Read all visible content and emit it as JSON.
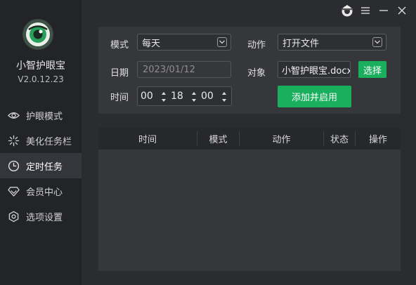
{
  "app": {
    "name": "小智护眼宝",
    "version": "V2.0.12.23"
  },
  "nav": {
    "items": [
      {
        "label": "护眼模式",
        "icon": "eye-icon"
      },
      {
        "label": "美化任务栏",
        "icon": "sparkle-icon"
      },
      {
        "label": "定时任务",
        "icon": "clock-icon",
        "active": true
      },
      {
        "label": "会员中心",
        "icon": "diamond-icon"
      },
      {
        "label": "选项设置",
        "icon": "settings-icon"
      }
    ]
  },
  "titlebar": {
    "icons": [
      "avatar-icon",
      "menu-icon",
      "minimize-icon",
      "close-icon"
    ]
  },
  "form": {
    "mode_label": "模式",
    "mode_value": "每天",
    "action_label": "动作",
    "action_value": "打开文件",
    "date_label": "日期",
    "date_placeholder": "2023/01/12",
    "target_label": "对象",
    "target_value": "小智护眼宝.docx",
    "choose_button": "选择",
    "time_label": "时间",
    "time_hour": "00",
    "time_minute": "18",
    "time_second": "00",
    "add_button": "添加并启用"
  },
  "table": {
    "columns": [
      "时间",
      "模式",
      "动作",
      "状态",
      "操作"
    ],
    "rows": []
  },
  "colors": {
    "accent_green": "#1aaf5d",
    "sidebar_bg": "#232427",
    "main_bg": "#2b2c30",
    "panel_bg": "#36373b"
  }
}
